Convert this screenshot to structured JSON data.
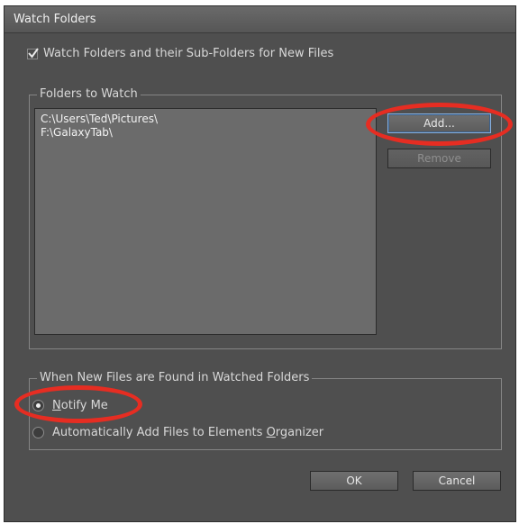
{
  "window": {
    "title": "Watch Folders"
  },
  "options": {
    "watch_subfolders_label": "Watch Folders and their Sub-Folders for New Files",
    "watch_subfolders_checked": true
  },
  "folders_group": {
    "legend": "Folders to Watch",
    "folders": [
      "C:\\Users\\Ted\\Pictures\\",
      "F:\\GalaxyTab\\"
    ],
    "add_label": "Add...",
    "remove_label": "Remove"
  },
  "new_files_group": {
    "legend": "When New Files are Found in Watched Folders",
    "notify_label_accel": "N",
    "notify_label_rest": "otify Me",
    "auto_add_label_prefix": "Automatically Add Files to Elements ",
    "auto_add_label_accel": "O",
    "auto_add_label_rest": "rganizer",
    "selected": "notify"
  },
  "footer": {
    "ok_label": "OK",
    "cancel_label": "Cancel"
  },
  "colors": {
    "dialog_bg": "#4f4f4f",
    "list_bg": "#6b6b6b",
    "annotation_red": "#e62d22",
    "focus_blue": "#88b0dd"
  }
}
